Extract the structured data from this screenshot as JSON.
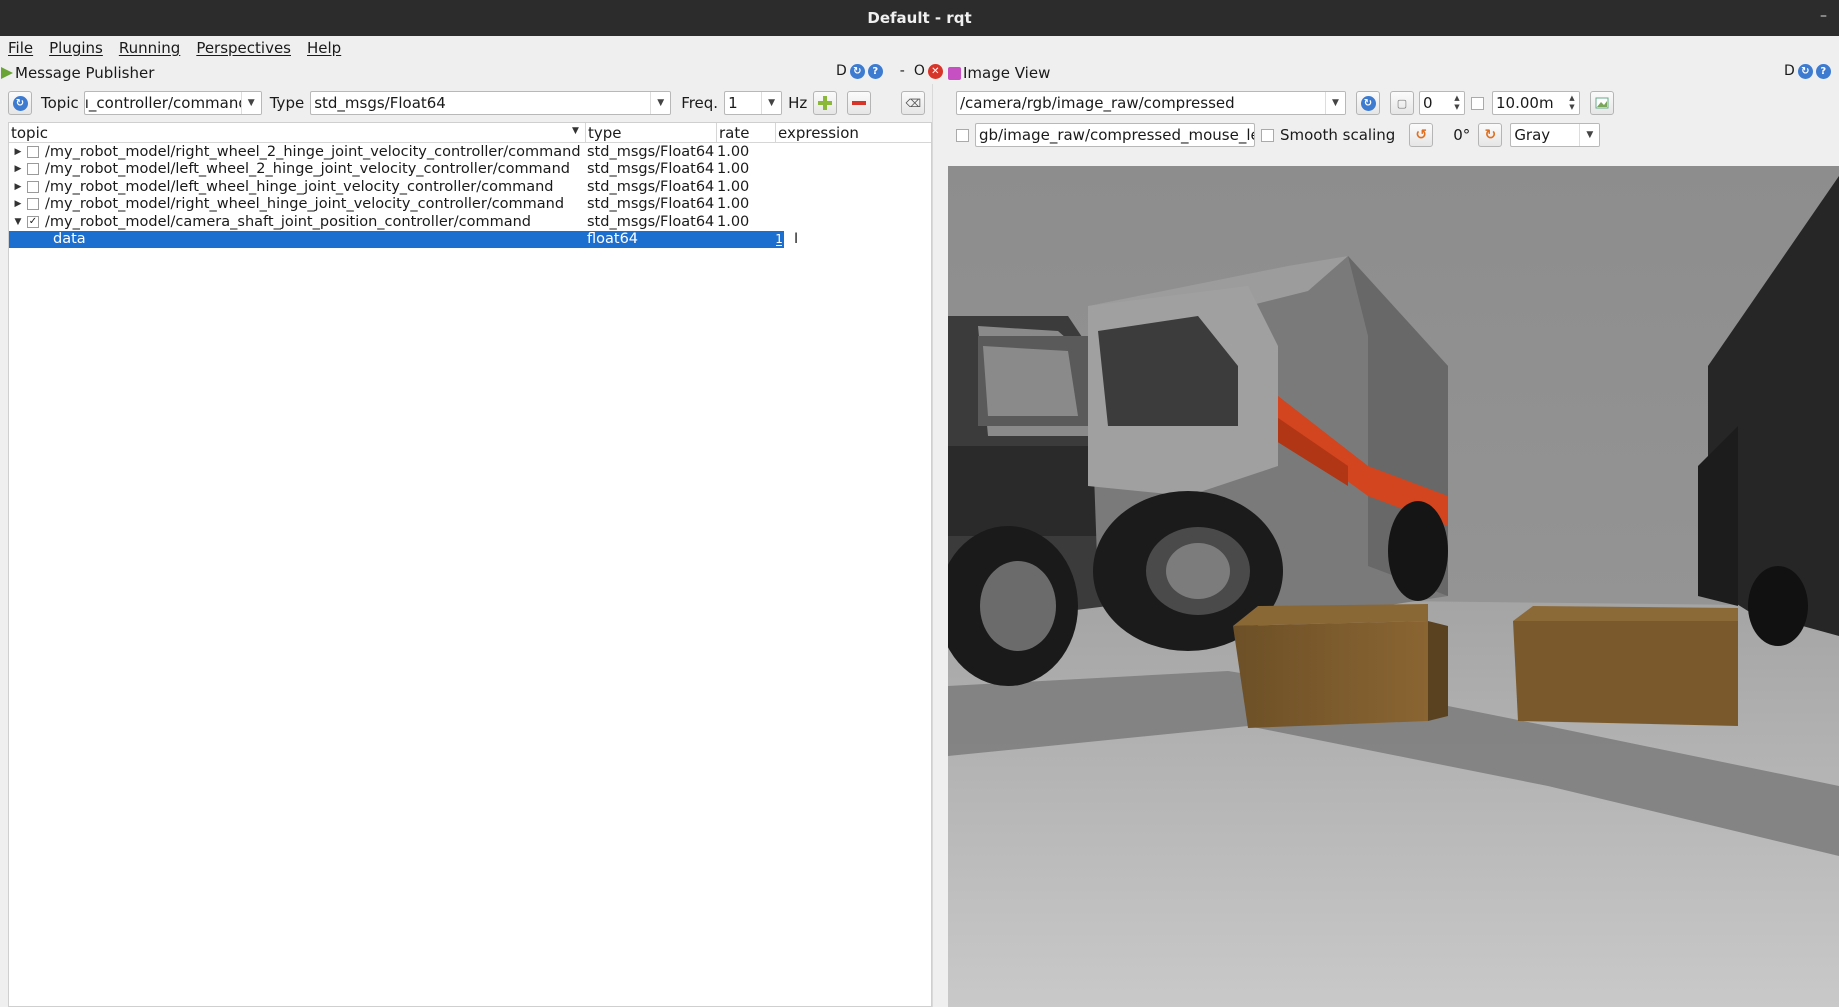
{
  "window": {
    "title": "Default - rqt"
  },
  "menu": [
    "File",
    "Plugins",
    "Running",
    "Perspectives",
    "Help"
  ],
  "publisher": {
    "panel_title": "Message Publisher",
    "topic_label": "Topic",
    "topic_value": "ı_controller/command",
    "type_label": "Type",
    "type_value": "std_msgs/Float64",
    "freq_label": "Freq.",
    "freq_value": "1",
    "hz_label": "Hz",
    "columns": [
      "topic",
      "type",
      "rate",
      "expression"
    ],
    "rows": [
      {
        "topic": "/my_robot_model/right_wheel_2_hinge_joint_velocity_controller/command",
        "type": "std_msgs/Float64",
        "rate": "1.00",
        "checked": false
      },
      {
        "topic": "/my_robot_model/left_wheel_2_hinge_joint_velocity_controller/command",
        "type": "std_msgs/Float64",
        "rate": "1.00",
        "checked": false
      },
      {
        "topic": "/my_robot_model/left_wheel_hinge_joint_velocity_controller/command",
        "type": "std_msgs/Float64",
        "rate": "1.00",
        "checked": false
      },
      {
        "topic": "/my_robot_model/right_wheel_hinge_joint_velocity_controller/command",
        "type": "std_msgs/Float64",
        "rate": "1.00",
        "checked": false
      },
      {
        "topic": "/my_robot_model/camera_shaft_joint_position_controller/command",
        "type": "std_msgs/Float64",
        "rate": "1.00",
        "checked": true
      }
    ],
    "child_row": {
      "topic": "data",
      "type": "float64",
      "expression": "1"
    }
  },
  "header_buttons": {
    "d": "D",
    "dash": "-",
    "o": "O"
  },
  "image_view": {
    "panel_title": "Image View",
    "topic": "/camera/rgb/image_raw/compressed",
    "zoom_value": "0",
    "max_depth": "10.00m",
    "mouse_topic": "gb/image_raw/compressed_mouse_left",
    "smooth_label": "Smooth scaling",
    "rotation": "0°",
    "color_scheme": "Gray"
  },
  "colors": {
    "selection": "#1d6fcf",
    "titlebar": "#2c2c2c",
    "ambulance_stripe": "#d2451e"
  }
}
